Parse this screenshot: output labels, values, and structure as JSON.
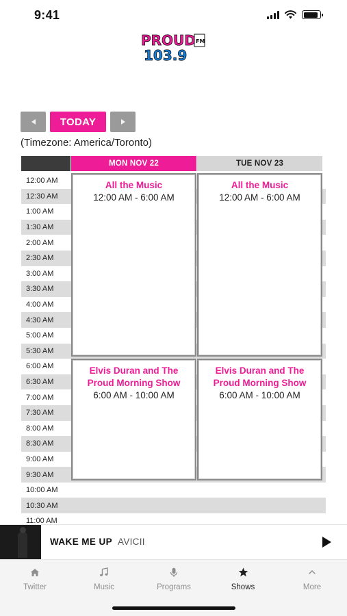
{
  "status_bar": {
    "time": "9:41",
    "signal_icon": "cellular-signal-icon",
    "wifi_icon": "wifi-icon",
    "battery_icon": "battery-icon",
    "battery_level": 0.9
  },
  "logo": {
    "text_top": "PROUD",
    "text_fm": "FM",
    "text_bottom": "103.9",
    "brand_pink": "#ee1c96",
    "brand_blue": "#1a7fd9"
  },
  "date_nav": {
    "prev_icon": "chevron-left-icon",
    "today_label": "TODAY",
    "next_icon": "chevron-right-icon",
    "timezone": "(Timezone: America/Toronto)"
  },
  "schedule": {
    "days": [
      {
        "label": "MON NOV 22",
        "active": true
      },
      {
        "label": "TUE NOV 23",
        "active": false
      }
    ],
    "times": [
      "12:00 AM",
      "12:30 AM",
      "1:00 AM",
      "1:30 AM",
      "2:00 AM",
      "2:30 AM",
      "3:00 AM",
      "3:30 AM",
      "4:00 AM",
      "4:30 AM",
      "5:00 AM",
      "5:30 AM",
      "6:00 AM",
      "6:30 AM",
      "7:00 AM",
      "7:30 AM",
      "8:00 AM",
      "8:30 AM",
      "9:00 AM",
      "9:30 AM",
      "10:00 AM",
      "10:30 AM",
      "11:00 AM"
    ],
    "shows": {
      "mon_all_music": {
        "title": "All the Music",
        "time": "12:00 AM - 6:00 AM"
      },
      "mon_elvis": {
        "title": "Elvis Duran and The Proud Morning Show",
        "time": "6:00 AM - 10:00 AM"
      },
      "tue_all_music": {
        "title": "All the Music",
        "time": "12:00 AM - 6:00 AM"
      },
      "tue_elvis": {
        "title": "Elvis Duran and The Proud Morning Show",
        "time": "6:00 AM - 10:00 AM"
      }
    },
    "accent_color": "#ee1c96"
  },
  "now_playing": {
    "title": "WAKE ME UP",
    "artist": "AVICII",
    "play_icon": "play-icon"
  },
  "tabs": [
    {
      "label": "Twitter",
      "icon": "home-icon",
      "active": false
    },
    {
      "label": "Music",
      "icon": "music-note-icon",
      "active": false
    },
    {
      "label": "Programs",
      "icon": "microphone-icon",
      "active": false
    },
    {
      "label": "Shows",
      "icon": "star-icon",
      "active": true
    },
    {
      "label": "More",
      "icon": "chevron-up-icon",
      "active": false
    }
  ]
}
